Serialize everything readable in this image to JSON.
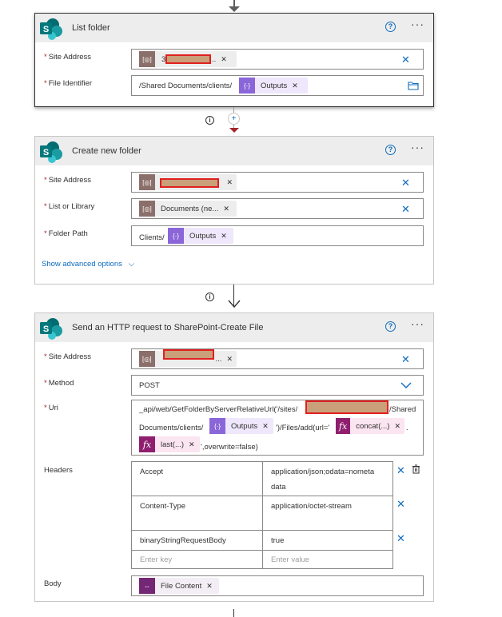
{
  "cards": {
    "list_folder": {
      "title": "List folder",
      "site_address_label": "Site Address",
      "site_address_token_suffix": "...",
      "file_identifier_label": "File Identifier",
      "file_identifier_prefix": "/Shared Documents/clients/",
      "file_identifier_token": "Outputs"
    },
    "create_folder": {
      "title": "Create new folder",
      "site_address_label": "Site Address",
      "list_label": "List or Library",
      "list_token": "Documents (ne...",
      "folder_path_label": "Folder Path",
      "folder_path_prefix": "Clients/",
      "folder_path_token": "Outputs",
      "advanced_link": "Show advanced options"
    },
    "http_request": {
      "title": "Send an HTTP request to SharePoint-Create File",
      "site_address_label": "Site Address",
      "site_address_token_suffix": "...",
      "method_label": "Method",
      "method_value": "POST",
      "uri_label": "Uri",
      "uri_line1_prefix": "_api/web/GetFolderByServerRelativeUrl('/sites/",
      "uri_line1_suffix": "/Shared",
      "uri_line2_prefix": "Documents/clients/",
      "uri_outputs_token": "Outputs",
      "uri_line2_mid": "')/Files/add(url='",
      "uri_concat_token": "concat(...)",
      "uri_concat_after": ".",
      "uri_last_token": "last(...)",
      "uri_line3_suffix": "',overwrite=false)",
      "headers_label": "Headers",
      "headers": [
        {
          "key": "Accept",
          "value_line1": "application/json;odata=nometa",
          "value_line2": "data"
        },
        {
          "key": "Content-Type",
          "value_line1": "application/octet-stream",
          "value_line2": ""
        },
        {
          "key": "binaryStringRequestBody",
          "value_line1": "true",
          "value_line2": ""
        }
      ],
      "enter_key_placeholder": "Enter key",
      "enter_value_placeholder": "Enter value",
      "body_label": "Body",
      "body_token": "File Content"
    }
  },
  "symbols": {
    "required": "*",
    "help": "?",
    "more": "···",
    "clear": "✕",
    "remove": "✕",
    "info": "i",
    "chevron": "⌵",
    "dynamic_icon": "{·}",
    "fx_icon": "fx"
  },
  "colors": {
    "accent": "#0f6cbd",
    "required": "#a4262c",
    "header_bg": "#ededed",
    "sharepoint_teal": "#038387",
    "redaction": "#c9a07a"
  }
}
